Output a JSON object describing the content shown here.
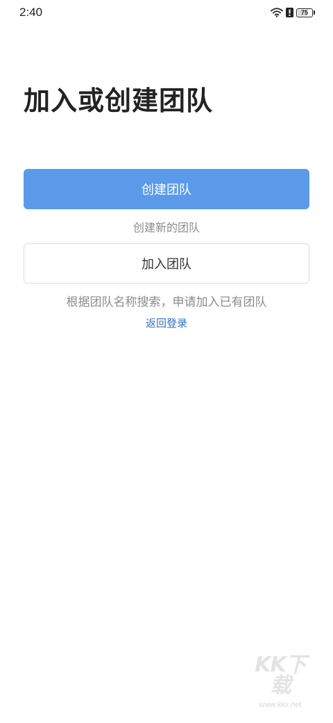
{
  "status_bar": {
    "time": "2:40",
    "battery_level": "75",
    "battery_fraction": 0.75,
    "icons": [
      "wifi-icon",
      "alert-icon",
      "battery-icon"
    ]
  },
  "title": "加入或创建团队",
  "create": {
    "button_label": "创建团队",
    "hint": "创建新的团队",
    "color": "#5b9ae9"
  },
  "join": {
    "button_label": "加入团队",
    "hint": "根据团队名称搜索，申请加入已有团队"
  },
  "back_link": "返回登录",
  "watermark": {
    "logo": "KK下载",
    "url": "www.kkx.net"
  }
}
